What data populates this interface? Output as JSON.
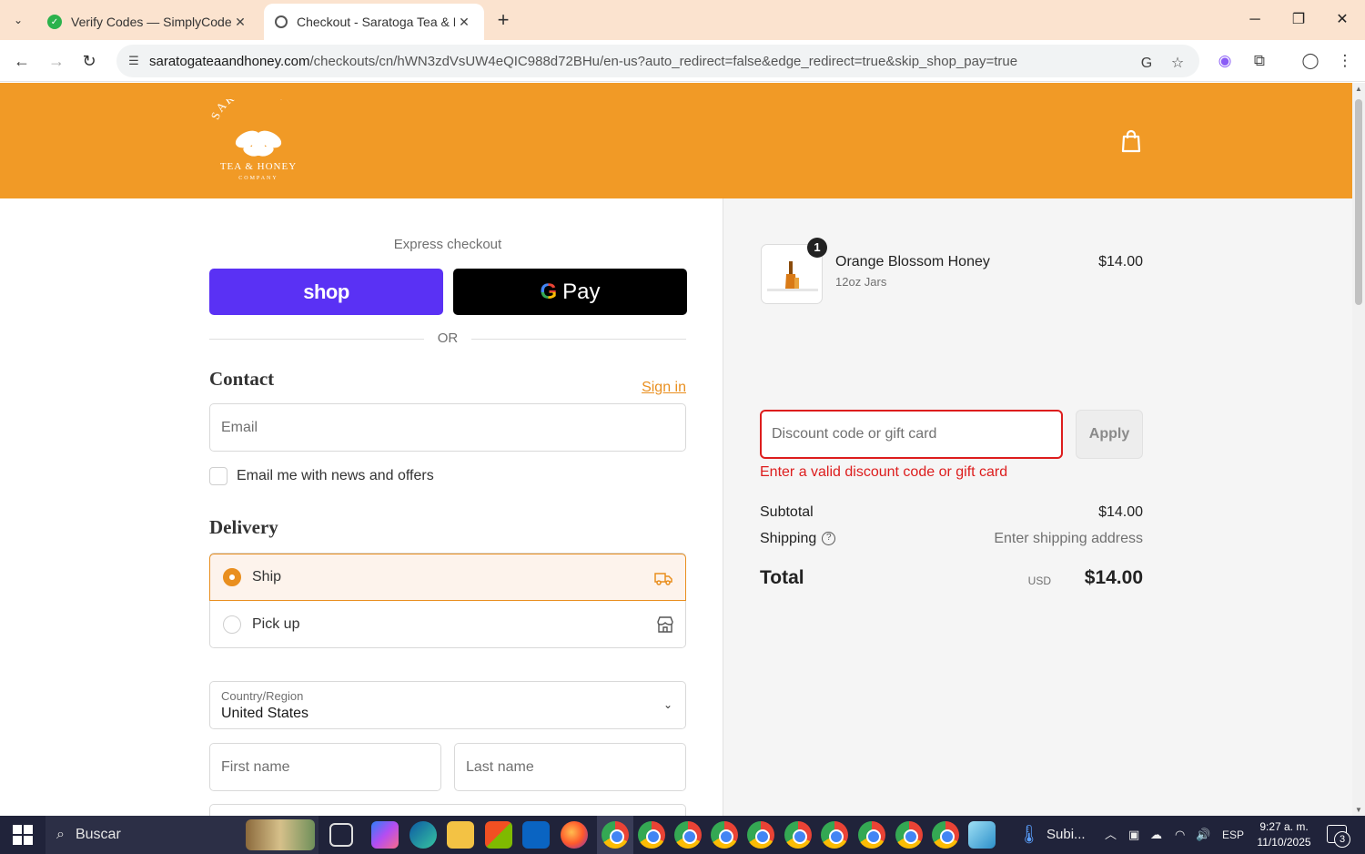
{
  "browser": {
    "tabs": [
      {
        "title": "Verify Codes — SimplyCodes",
        "favicon": "simplycodes-icon",
        "favicon_color": "#2bb24c"
      },
      {
        "title": "Checkout - Saratoga Tea & Hon",
        "favicon": "globe-icon",
        "favicon_color": "#555555"
      }
    ],
    "url_host": "saratogateaandhoney.com",
    "url_path": "/checkouts/cn/hWN3zdVsUW4eQIC988d72BHu/en-us?auto_redirect=false&edge_redirect=true&skip_shop_pay=true"
  },
  "header": {
    "brand_color": "#f19a26",
    "logo_text_top": "SARATOGA",
    "logo_text_bottom": "TEA & HONEY",
    "logo_text_sub": "COMPANY"
  },
  "checkout": {
    "express_label": "Express checkout",
    "shop_pay_label": "shop",
    "gpay_label": "Pay",
    "gpay_g": "G",
    "or_label": "OR",
    "contact_title": "Contact",
    "sign_in": "Sign in",
    "email_placeholder": "Email",
    "news_label": "Email me with news and offers",
    "delivery_title": "Delivery",
    "ship_label": "Ship",
    "pickup_label": "Pick up",
    "country_label": "Country/Region",
    "country_value": "United States",
    "first_name_placeholder": "First name",
    "last_name_placeholder": "Last name",
    "accent_color": "#e98f1f"
  },
  "summary": {
    "item": {
      "quantity": "1",
      "name": "Orange Blossom Honey",
      "variant": "12oz Jars",
      "price": "$14.00"
    },
    "discount_placeholder": "Discount code or gift card",
    "apply_label": "Apply",
    "error_message": "Enter a valid discount code or gift card",
    "error_color": "#dd1d1d",
    "subtotal_label": "Subtotal",
    "subtotal_value": "$14.00",
    "shipping_label": "Shipping",
    "shipping_value": "Enter shipping address",
    "total_label": "Total",
    "total_currency": "USD",
    "total_value": "$14.00"
  },
  "taskbar": {
    "search_label": "Buscar",
    "tray_label": "Subi...",
    "language": "ESP",
    "time": "9:27 a. m.",
    "date": "11/10/2025",
    "notifications": "3"
  }
}
